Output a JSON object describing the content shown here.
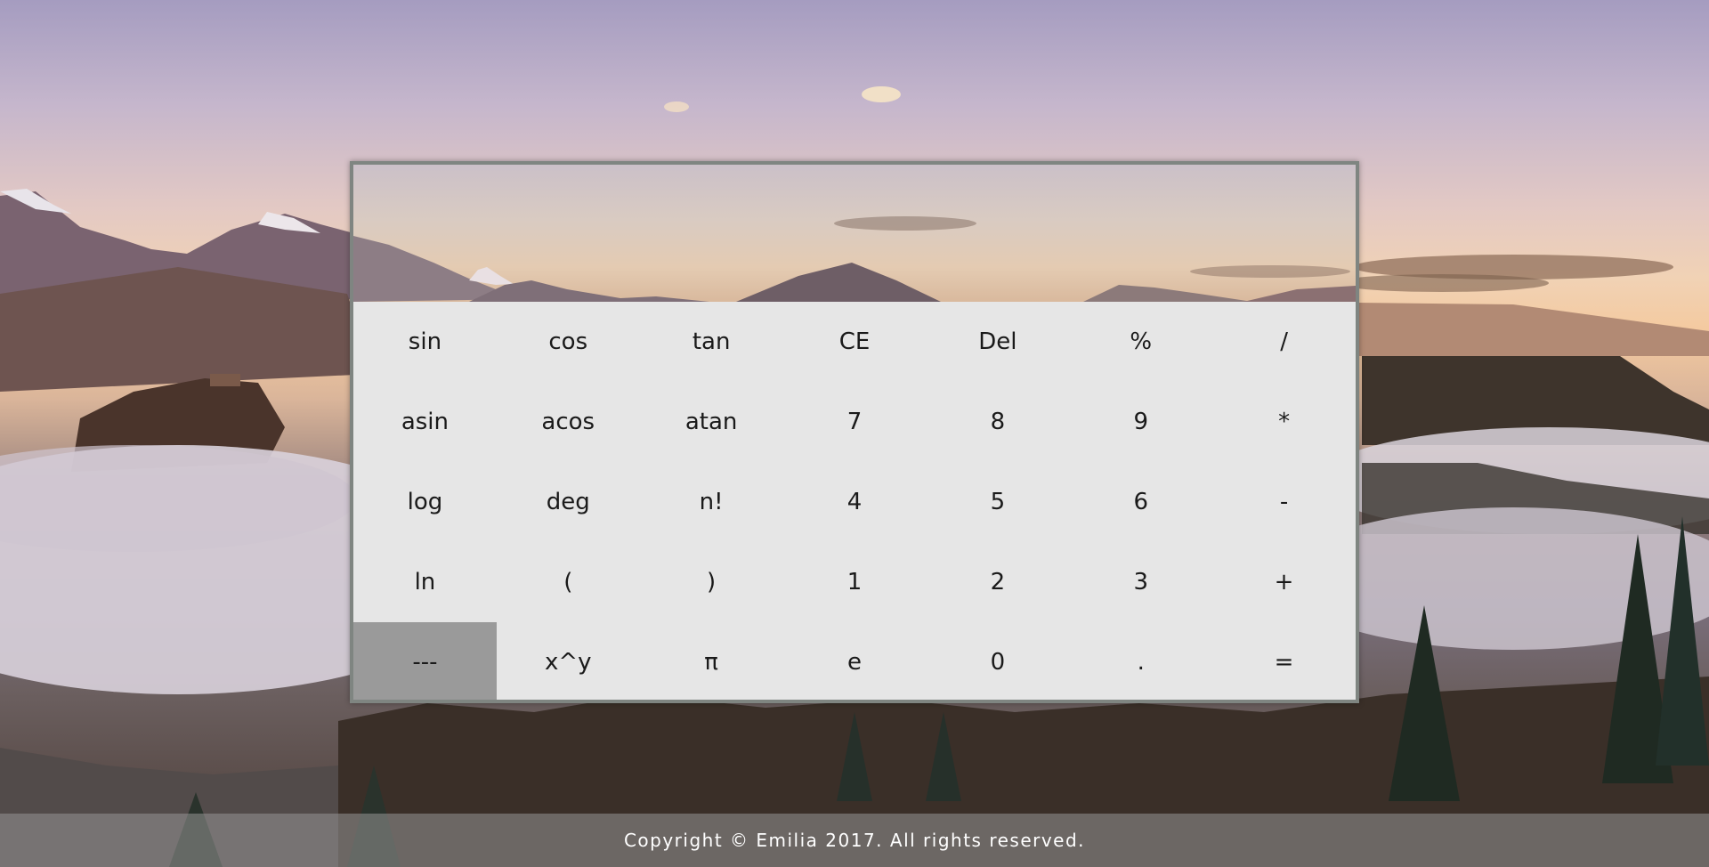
{
  "display": {
    "value": ""
  },
  "keys": [
    {
      "label": "sin",
      "name": "key-sin"
    },
    {
      "label": "cos",
      "name": "key-cos"
    },
    {
      "label": "tan",
      "name": "key-tan"
    },
    {
      "label": "CE",
      "name": "key-clear-entry"
    },
    {
      "label": "Del",
      "name": "key-delete"
    },
    {
      "label": "%",
      "name": "key-percent"
    },
    {
      "label": "/",
      "name": "key-divide"
    },
    {
      "label": "asin",
      "name": "key-asin"
    },
    {
      "label": "acos",
      "name": "key-acos"
    },
    {
      "label": "atan",
      "name": "key-atan"
    },
    {
      "label": "7",
      "name": "key-7"
    },
    {
      "label": "8",
      "name": "key-8"
    },
    {
      "label": "9",
      "name": "key-9"
    },
    {
      "label": "*",
      "name": "key-multiply"
    },
    {
      "label": "log",
      "name": "key-log"
    },
    {
      "label": "deg",
      "name": "key-deg"
    },
    {
      "label": "n!",
      "name": "key-factorial"
    },
    {
      "label": "4",
      "name": "key-4"
    },
    {
      "label": "5",
      "name": "key-5"
    },
    {
      "label": "6",
      "name": "key-6"
    },
    {
      "label": "-",
      "name": "key-minus"
    },
    {
      "label": "ln",
      "name": "key-ln"
    },
    {
      "label": "(",
      "name": "key-open-paren"
    },
    {
      "label": ")",
      "name": "key-close-paren"
    },
    {
      "label": "1",
      "name": "key-1"
    },
    {
      "label": "2",
      "name": "key-2"
    },
    {
      "label": "3",
      "name": "key-3"
    },
    {
      "label": "+",
      "name": "key-plus"
    },
    {
      "label": "---",
      "name": "key-toggle-mode",
      "active": true
    },
    {
      "label": "x^y",
      "name": "key-power"
    },
    {
      "label": "π",
      "name": "key-pi"
    },
    {
      "label": "e",
      "name": "key-e"
    },
    {
      "label": "0",
      "name": "key-0"
    },
    {
      "label": ".",
      "name": "key-decimal"
    },
    {
      "label": "=",
      "name": "key-equals"
    }
  ],
  "footer": {
    "text": "Copyright © Emilia 2017. All rights reserved."
  },
  "colors": {
    "keypad_bg": "#e6e6e6",
    "active_key_bg": "#9a9a9a",
    "frame_border": "#7f8581"
  }
}
